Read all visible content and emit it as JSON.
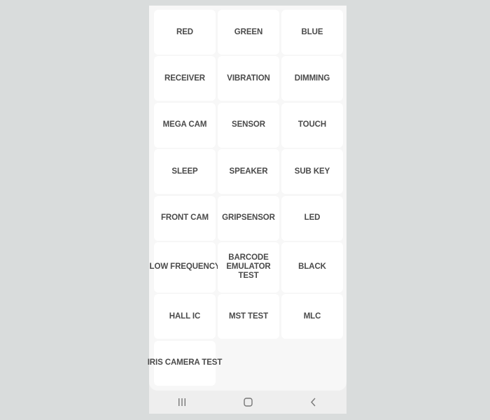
{
  "tests": [
    {
      "label": "RED"
    },
    {
      "label": "GREEN"
    },
    {
      "label": "BLUE"
    },
    {
      "label": "RECEIVER"
    },
    {
      "label": "VIBRATION"
    },
    {
      "label": "DIMMING"
    },
    {
      "label": "MEGA CAM"
    },
    {
      "label": "SENSOR"
    },
    {
      "label": "TOUCH"
    },
    {
      "label": "SLEEP"
    },
    {
      "label": "SPEAKER"
    },
    {
      "label": "SUB KEY"
    },
    {
      "label": "FRONT CAM"
    },
    {
      "label": "GRIPSENSOR"
    },
    {
      "label": "LED"
    },
    {
      "label": "LOW FREQUENCY"
    },
    {
      "label": "BARCODE EMULATOR TEST"
    },
    {
      "label": "BLACK"
    },
    {
      "label": "HALL IC"
    },
    {
      "label": "MST TEST"
    },
    {
      "label": "MLC"
    },
    {
      "label": "IRIS CAMERA TEST"
    }
  ],
  "navbar": {
    "recents_icon": "recent-apps-icon",
    "home_icon": "home-icon",
    "back_icon": "back-icon"
  }
}
